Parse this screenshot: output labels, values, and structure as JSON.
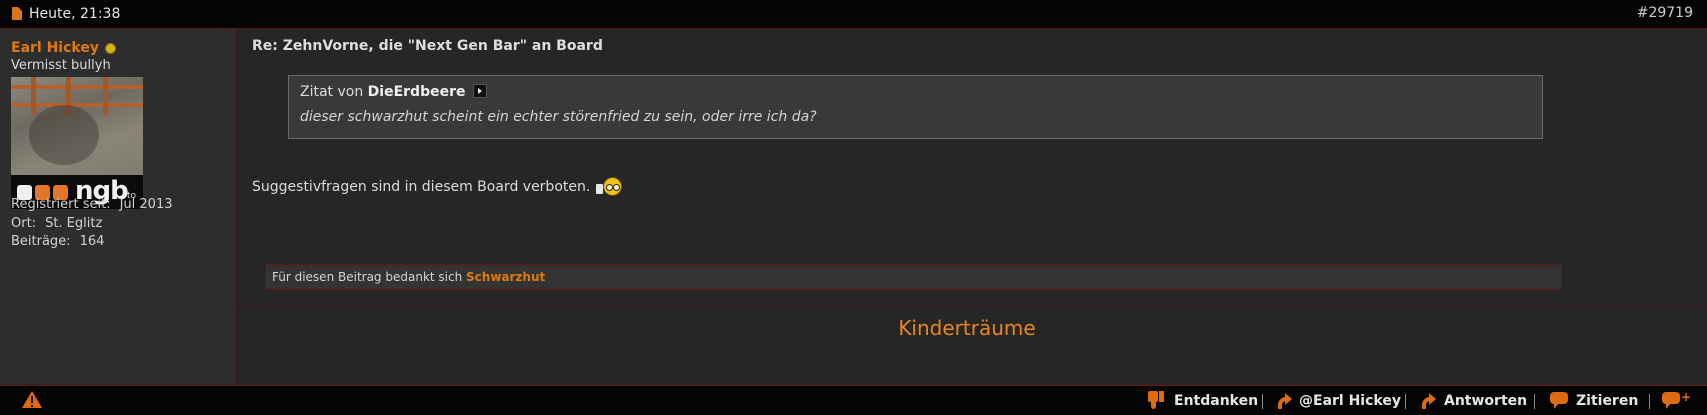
{
  "header": {
    "date": "Heute, 21:38",
    "post_number": "#29719"
  },
  "author": {
    "name": "Earl Hickey",
    "title": "Vermisst bullyh",
    "avatar_text": "ngb",
    "avatar_sub": "to",
    "info": [
      {
        "label": "Registriert seit:",
        "value": "Jul 2013"
      },
      {
        "label": "Ort:",
        "value": "St. Eglitz"
      },
      {
        "label": "Beiträge:",
        "value": "164"
      }
    ]
  },
  "post": {
    "title": "Re: ZehnVorne, die \"Next Gen Bar\" an Board",
    "quote": {
      "prefix": "Zitat von",
      "author": "DieErdbeere",
      "text": "dieser schwarzhut scheint ein echter störenfried zu sein, oder irre ich da?"
    },
    "body": "Suggestivfragen sind in diesem Board verboten.",
    "thanks": {
      "text": "Für diesen Beitrag bedankt sich",
      "user": "Schwarzhut"
    },
    "signature": "Kinderträume"
  },
  "actions": [
    {
      "label": "Entdanken",
      "icon": "thumbs-down-icon"
    },
    {
      "label": "@Earl Hickey",
      "icon": "reply-arrow-icon"
    },
    {
      "label": "Antworten",
      "icon": "reply-arrow-icon"
    },
    {
      "label": "Zitieren",
      "icon": "speech-bubble-icon"
    },
    {
      "label": "",
      "icon": "multiquote-plus-icon"
    }
  ],
  "colors": {
    "accent": "#e07a10",
    "background": "#262626",
    "bar": "#050505"
  }
}
